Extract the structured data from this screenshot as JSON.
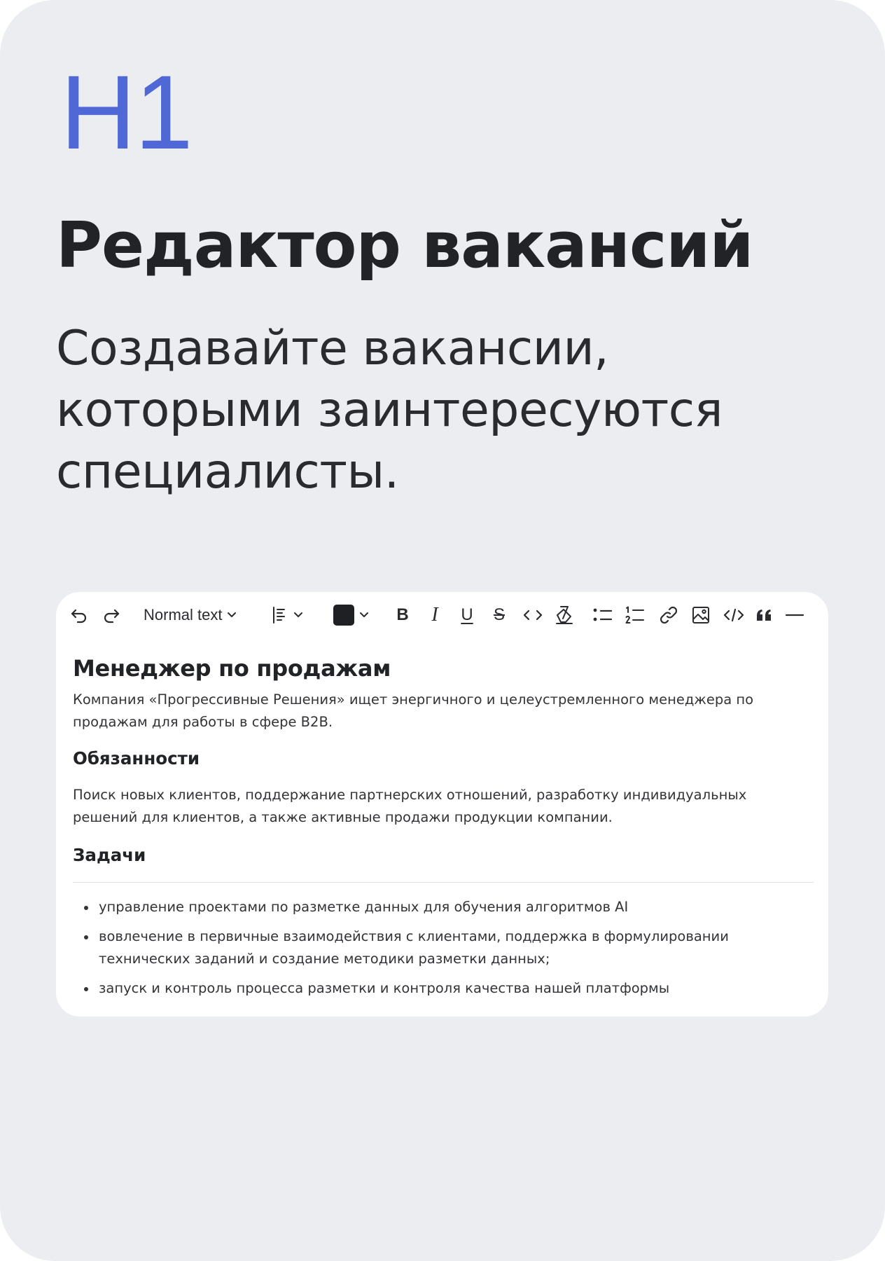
{
  "header": {
    "badge": "H1",
    "title": "Редактор вакансий",
    "subtitle_lines": [
      "Создавайте вакансии,",
      "которыми заинтересуются",
      "специалисты."
    ]
  },
  "toolbar": {
    "undo_icon": "undo-icon",
    "redo_icon": "redo-icon",
    "text_style": "Normal text",
    "text_color": "#1f2024",
    "bold_label": "B",
    "italic_label": "I",
    "underline_label": "U",
    "strike_label": "S"
  },
  "document": {
    "title": "Менеджер по продажам",
    "intro_lines": [
      "Компания «Прогрессивные Решения» ищет энергичного и целеустремленного менеджера по",
      "продажам для работы в сфере B2B."
    ],
    "section1_heading": "Обязанности",
    "section1_lines": [
      "Поиск новых клиентов, поддержание партнерских отношений, разработку индивидуальных",
      "решений для клиентов, а также активные продажи продукции компании."
    ],
    "section2_heading": "Задачи",
    "bullets": [
      {
        "lines": [
          "управление проектами по разметке данных для обучения алгоритмов AI"
        ]
      },
      {
        "lines": [
          "вовлечение в первичные взаимодействия с клиентами, поддержка в формулировании",
          "технических заданий и создание методики разметки данных;"
        ]
      },
      {
        "lines": [
          "запуск и контроль процесса разметки и контроля качества нашей платформы"
        ]
      }
    ]
  },
  "colors": {
    "background": "#ecedf1",
    "accent": "#4f68d6",
    "text": "#222326"
  }
}
